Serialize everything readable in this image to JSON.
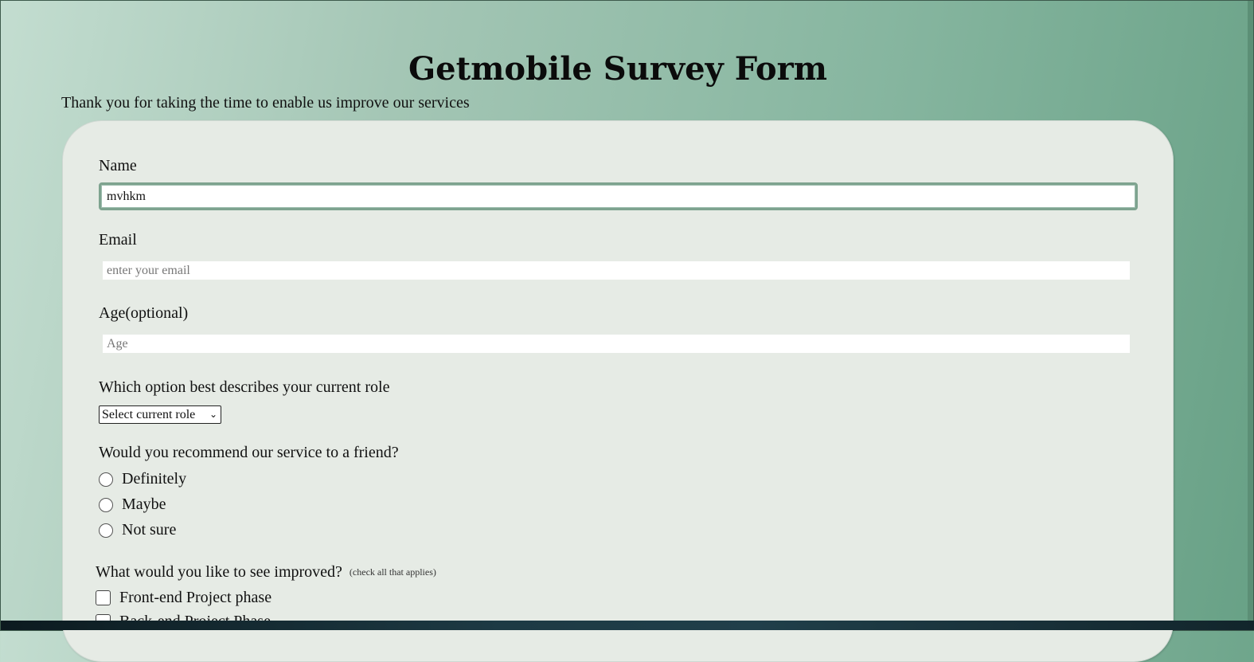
{
  "page": {
    "title": "Getmobile Survey Form",
    "subtitle": "Thank you for taking the time to enable us improve our services"
  },
  "form": {
    "name": {
      "label": "Name",
      "value": "mvhkm"
    },
    "email": {
      "label": "Email",
      "placeholder": "enter your email"
    },
    "age": {
      "label": "Age(optional)",
      "placeholder": "Age"
    },
    "role": {
      "label": "Which option best describes your current role",
      "selected": "Select current role"
    },
    "recommend": {
      "label": "Would you recommend our service to a friend?",
      "options": [
        "Definitely",
        "Maybe",
        "Not sure"
      ]
    },
    "improve": {
      "label": "What would you like to see improved?",
      "hint": "(check all that applies)",
      "options": [
        "Front-end Project phase",
        "Back-end Project Phase"
      ]
    }
  },
  "colors": {
    "background_start": "#c3ddd0",
    "background_end": "#68a186",
    "card": "#e6ebe5",
    "focus_border": "#7ea38f"
  }
}
